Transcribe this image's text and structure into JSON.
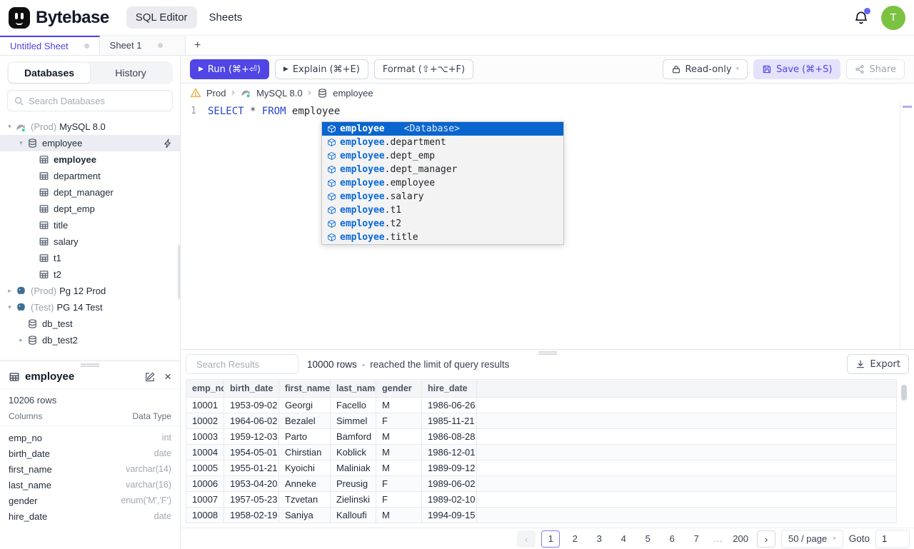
{
  "colors": {
    "accent": "#4f46e5",
    "avatar_green": "#7cc242",
    "notification_badge_purple": "#6366f1",
    "sql_keyword_blue": "#2543cc",
    "autocomplete_selected_blue": "#0a65cf",
    "warning_amber": "#f59e0b",
    "postgres_blue": "#3d6e93",
    "mysql_status_green": "#34d399"
  },
  "header": {
    "brand": "Bytebase",
    "nav": [
      {
        "label": "SQL Editor",
        "active": true
      },
      {
        "label": "Sheets",
        "active": false
      }
    ],
    "avatar_initial": "T"
  },
  "sheet_tabs": {
    "tabs": [
      {
        "label": "Untitled Sheet",
        "active": true
      },
      {
        "label": "Sheet 1",
        "active": false
      }
    ],
    "new_tab": "+"
  },
  "sidebar": {
    "tabs": [
      {
        "label": "Databases",
        "active": true
      },
      {
        "label": "History",
        "active": false
      }
    ],
    "search_placeholder": "Search Databases",
    "tree": [
      {
        "indent": 0,
        "caret": "down",
        "icon": "mysql-icon",
        "prefix": "(Prod)",
        "name": "MySQL 8.0"
      },
      {
        "indent": 1,
        "caret": "down",
        "icon": "database-icon",
        "name": "employee",
        "selected": true,
        "action": "bolt-icon"
      },
      {
        "indent": 2,
        "caret": null,
        "icon": "table-icon",
        "name": "employee",
        "bold": true
      },
      {
        "indent": 2,
        "caret": null,
        "icon": "table-icon",
        "name": "department"
      },
      {
        "indent": 2,
        "caret": null,
        "icon": "table-icon",
        "name": "dept_manager"
      },
      {
        "indent": 2,
        "caret": null,
        "icon": "table-icon",
        "name": "dept_emp"
      },
      {
        "indent": 2,
        "caret": null,
        "icon": "table-icon",
        "name": "title"
      },
      {
        "indent": 2,
        "caret": null,
        "icon": "table-icon",
        "name": "salary"
      },
      {
        "indent": 2,
        "caret": null,
        "icon": "table-icon",
        "name": "t1"
      },
      {
        "indent": 2,
        "caret": null,
        "icon": "table-icon",
        "name": "t2"
      },
      {
        "indent": 0,
        "caret": "right",
        "icon": "postgres-icon",
        "prefix": "(Prod)",
        "name": "Pg 12 Prod"
      },
      {
        "indent": 0,
        "caret": "down",
        "icon": "postgres-icon",
        "prefix": "(Test)",
        "name": "PG 14 Test"
      },
      {
        "indent": 1,
        "caret": null,
        "icon": "database-icon",
        "name": "db_test"
      },
      {
        "indent": 1,
        "caret": "right",
        "icon": "database-icon",
        "name": "db_test2"
      }
    ]
  },
  "schema_panel": {
    "table_name": "employee",
    "row_count": "10206 rows",
    "columns_header": "Columns",
    "type_header": "Data Type",
    "columns": [
      {
        "name": "emp_no",
        "type": "int"
      },
      {
        "name": "birth_date",
        "type": "date"
      },
      {
        "name": "first_name",
        "type": "varchar(14)"
      },
      {
        "name": "last_name",
        "type": "varchar(16)"
      },
      {
        "name": "gender",
        "type": "enum('M','F')"
      },
      {
        "name": "hire_date",
        "type": "date"
      }
    ]
  },
  "toolbar": {
    "run_label": "Run (⌘+⏎)",
    "explain_label": "Explain (⌘+E)",
    "format_label": "Format (⇧+⌥+F)",
    "readonly_label": "Read-only",
    "save_label": "Save (⌘+S)",
    "share_label": "Share"
  },
  "breadcrumb": {
    "environment": "Prod",
    "separator": "›",
    "instance": "MySQL 8.0",
    "database": "employee"
  },
  "editor": {
    "line_number": "1",
    "keyword_select": "SELECT",
    "star": "*",
    "keyword_from": "FROM",
    "table_ref": "employee"
  },
  "autocomplete": {
    "selected_label": "employee",
    "selected_hint": "<Database>",
    "prefix": "employee",
    "items": [
      ".department",
      ".dept_emp",
      ".dept_manager",
      ".employee",
      ".salary",
      ".t1",
      ".t2",
      ".title"
    ]
  },
  "results": {
    "search_placeholder": "Search Results",
    "row_count": "10000 rows",
    "separator": "-",
    "limit_note": "reached the limit of query results",
    "export_label": "Export",
    "table": {
      "headers": [
        "emp_no",
        "birth_date",
        "first_name",
        "last_name",
        "gender",
        "hire_date"
      ],
      "rows": [
        [
          "10001",
          "1953-09-02",
          "Georgi",
          "Facello",
          "M",
          "1986-06-26"
        ],
        [
          "10002",
          "1964-06-02",
          "Bezalel",
          "Simmel",
          "F",
          "1985-11-21"
        ],
        [
          "10003",
          "1959-12-03",
          "Parto",
          "Bamford",
          "M",
          "1986-08-28"
        ],
        [
          "10004",
          "1954-05-01",
          "Chirstian",
          "Koblick",
          "M",
          "1986-12-01"
        ],
        [
          "10005",
          "1955-01-21",
          "Kyoichi",
          "Maliniak",
          "M",
          "1989-09-12"
        ],
        [
          "10006",
          "1953-04-20",
          "Anneke",
          "Preusig",
          "F",
          "1989-06-02"
        ],
        [
          "10007",
          "1957-05-23",
          "Tzvetan",
          "Zielinski",
          "F",
          "1989-02-10"
        ],
        [
          "10008",
          "1958-02-19",
          "Saniya",
          "Kalloufi",
          "M",
          "1994-09-15"
        ]
      ]
    }
  },
  "pagination": {
    "pages": [
      "1",
      "2",
      "3",
      "4",
      "5",
      "6",
      "7"
    ],
    "active_page": "1",
    "ellipsis": "…",
    "last_page": "200",
    "page_size": "50 / page",
    "goto_label": "Goto",
    "goto_value": "1"
  }
}
